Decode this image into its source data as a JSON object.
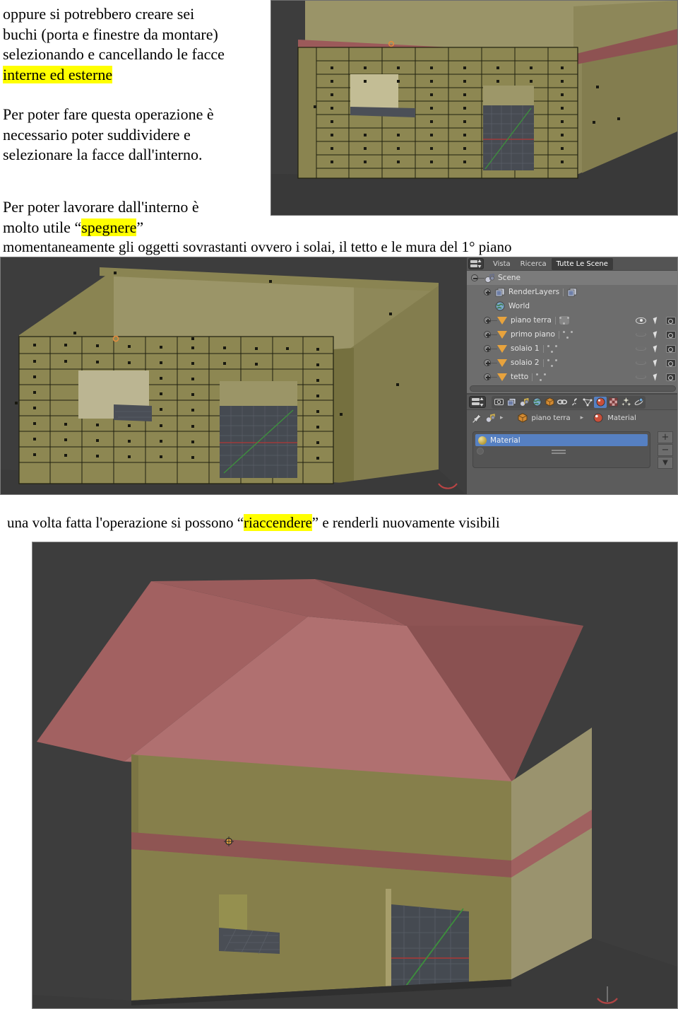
{
  "document": {
    "paragraph_1": {
      "line_1": "oppure si potrebbero creare sei",
      "line_2": "buchi   (porta e finestre da montare)",
      "line_3": "selezionando e cancellando le facce",
      "highlight": "interne ed esterne"
    },
    "paragraph_2": {
      "line_1": "Per poter fare questa operazione è",
      "line_2": "necessario poter suddividere e",
      "line_3": "selezionare la facce dall'interno."
    },
    "paragraph_3": {
      "line_1": "Per poter lavorare dall'interno è",
      "line_2_prefix": "molto utile “",
      "line_2_highlight": "spegnere",
      "line_2_suffix": "”"
    },
    "paragraph_4": "momentaneamente gli oggetti sovrastanti ovvero i solai, il tetto e le mura del 1° piano",
    "paragraph_5": {
      "prefix": "una volta fatta l'operazione si possono “",
      "highlight": "riaccendere",
      "suffix": "” e renderli nuovamente visibili"
    },
    "highlight_color": "#ffff00"
  },
  "blender": {
    "outliner": {
      "header": {
        "display_mode_icon": "outliner-display-mode-icon",
        "menus": [
          "Vista",
          "Ricerca"
        ],
        "selected_menu": "Tutte Le Scene"
      },
      "rows": [
        {
          "label": "Scene",
          "icon": "scene-icon",
          "indent": 0,
          "expander": "minus",
          "selected": true,
          "type": "scene"
        },
        {
          "label": "RenderLayers",
          "icon": "renderlayers-icon",
          "indent": 1,
          "expander": "plus",
          "selected": false,
          "type": "renderlayers"
        },
        {
          "label": "World",
          "icon": "world-icon",
          "indent": 1,
          "expander": "none",
          "selected": false,
          "type": "world"
        },
        {
          "label": "piano terra",
          "icon": "mesh-object-icon",
          "indent": 1,
          "expander": "plus",
          "selected": false,
          "type": "object",
          "visible": true,
          "selectable": true,
          "renderable": true
        },
        {
          "label": "primo piano",
          "icon": "mesh-object-icon",
          "indent": 1,
          "expander": "plus",
          "selected": false,
          "type": "object",
          "visible": false,
          "selectable": true,
          "renderable": true
        },
        {
          "label": "solaio 1",
          "icon": "mesh-object-icon",
          "indent": 1,
          "expander": "plus",
          "selected": false,
          "type": "object",
          "visible": false,
          "selectable": true,
          "renderable": true
        },
        {
          "label": "solaio 2",
          "icon": "mesh-object-icon",
          "indent": 1,
          "expander": "plus",
          "selected": false,
          "type": "object",
          "visible": false,
          "selectable": true,
          "renderable": true
        },
        {
          "label": "tetto",
          "icon": "mesh-object-icon",
          "indent": 1,
          "expander": "plus",
          "selected": false,
          "type": "object",
          "visible": false,
          "selectable": true,
          "renderable": true
        }
      ]
    },
    "properties": {
      "tabs": [
        {
          "name": "render",
          "icon": "camera-back-icon",
          "active": false
        },
        {
          "name": "render-layers",
          "icon": "render-layers-icon",
          "active": false
        },
        {
          "name": "scene",
          "icon": "scene-props-icon",
          "active": false
        },
        {
          "name": "world",
          "icon": "world-props-icon",
          "active": false
        },
        {
          "name": "object",
          "icon": "object-cube-icon",
          "active": false
        },
        {
          "name": "constraints",
          "icon": "chain-link-icon",
          "active": false
        },
        {
          "name": "modifiers",
          "icon": "wrench-icon",
          "active": false
        },
        {
          "name": "object-data",
          "icon": "mesh-data-icon",
          "active": false
        },
        {
          "name": "material",
          "icon": "material-ball-icon",
          "active": true
        },
        {
          "name": "texture",
          "icon": "checker-icon",
          "active": false
        },
        {
          "name": "particles",
          "icon": "particles-icon",
          "active": false
        },
        {
          "name": "physics",
          "icon": "physics-icon",
          "active": false
        }
      ],
      "breadcrumb": {
        "pin_icon": "pin-icon",
        "scene_icon": "scene-icon",
        "object_icon": "object-cube-icon",
        "object_label": "piano terra",
        "material_icon": "material-ball-icon",
        "material_label": "Material"
      },
      "material_slots": [
        {
          "label": "Material",
          "selected": true
        }
      ],
      "slot_buttons": [
        "+",
        "−",
        "▼"
      ]
    },
    "colors": {
      "viewport_background": "#3d3d3d",
      "wall_olive": "#85804a",
      "wall_olive_light": "#989270",
      "wall_side_dark": "#6f6a3e",
      "roof_red_light": "#a05f5f",
      "roof_red_dark": "#8e5454",
      "band_red": "#8a5250",
      "ground_grid": "#4a4e54",
      "panel_gray": "#5a5a5a",
      "outliner_gray": "#6d6d6d",
      "accent_blue": "#5680c2",
      "mesh_triangle_orange": "#e8a33d"
    }
  },
  "screenshots": {
    "top": {
      "name": "edit-mode-wall-interior-view",
      "description": "Blender 3D viewport, edit mode, subdivided wall faces with face dots, door and window openings"
    },
    "middle": {
      "name": "edit-mode-room-with-outliner",
      "description": "Blender 3D viewport showing room interior with subdivided walls, outliner and properties panel on the right"
    },
    "bottom": {
      "name": "full-house-render-view",
      "description": "Blender 3D viewport showing full house with hipped red roof, olive walls and red floor band"
    }
  }
}
